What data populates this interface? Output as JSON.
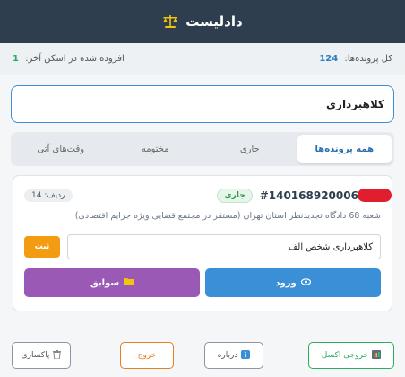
{
  "header": {
    "title": "دادلیست"
  },
  "stats": {
    "total_label": "کل پرونده‌ها:",
    "total_value": "124",
    "added_label": "افزوده شده در اسکن آخر:",
    "added_value": "1"
  },
  "search": {
    "value": "کلاهبرداری"
  },
  "tabs": [
    {
      "label": "همه پرونده‌ها"
    },
    {
      "label": "جاری"
    },
    {
      "label": "مختومه"
    },
    {
      "label": "وقت‌های آتی"
    }
  ],
  "card": {
    "case_number": "#140168920006893",
    "status": "جاری",
    "row": "ردیف: 14",
    "court": "شعبه 68 دادگاه تجدیدنظر استان تهران (مستقر در مجتمع قضایی ویژه جرایم اقتصادی)",
    "note_value": "کلاهبرداری شخص الف",
    "save_label": "ثبت",
    "login_label": "ورود",
    "history_label": "سوابق"
  },
  "footer": {
    "excel_label": "خروجی اکسل",
    "about_label": "درباره",
    "logout_label": "خروج",
    "clear_label": "پاکسازی"
  },
  "colors": {
    "header": "#2f3e4e",
    "accent": "#3a8fd6",
    "purple": "#9b59b6",
    "orange": "#f39c12",
    "green": "#27ae60"
  }
}
